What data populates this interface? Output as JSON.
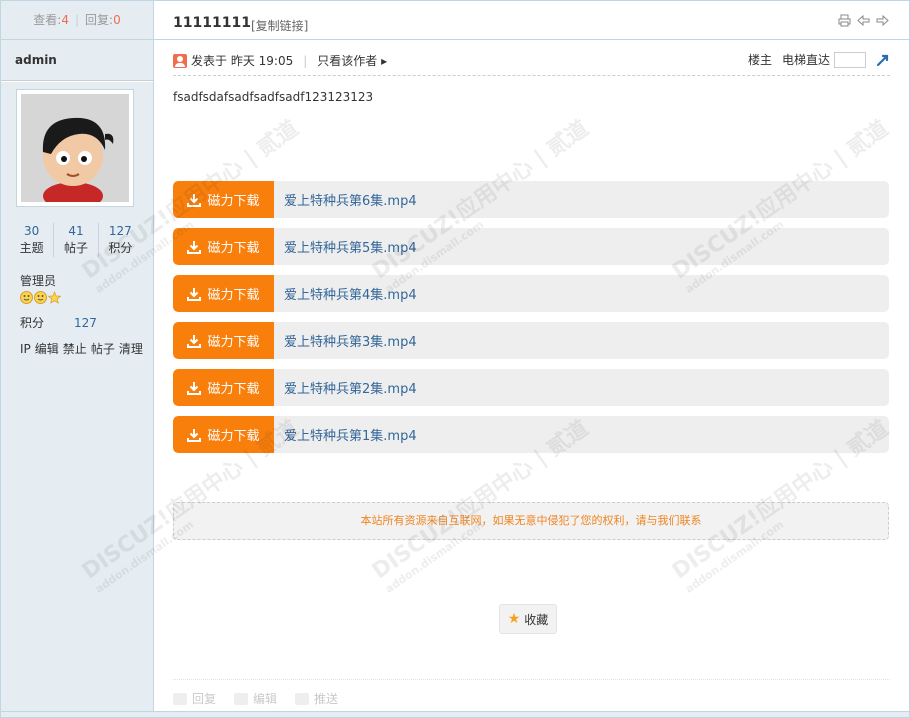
{
  "sidebar": {
    "views_label": "查看:",
    "views_value": "4",
    "replies_label": "回复:",
    "replies_value": "0",
    "author": "admin",
    "stats": [
      {
        "value": "30",
        "label": "主题"
      },
      {
        "value": "41",
        "label": "帖子"
      },
      {
        "value": "127",
        "label": "积分"
      }
    ],
    "group": "管理员",
    "score_label": "积分",
    "score_value": "127",
    "admin_links": [
      "IP",
      "编辑",
      "禁止",
      "帖子",
      "清理"
    ]
  },
  "header": {
    "title": "11111111",
    "copy_link": "[复制链接]"
  },
  "post": {
    "posted_label": "发表于 昨天 19:05",
    "only_author": "只看该作者",
    "floor_label": "楼主",
    "elevator_label": "电梯直达",
    "body_text": "fsadfsdafsadfsadfsadf123123123"
  },
  "downloads": {
    "button_label": "磁力下载",
    "items": [
      "爱上特种兵第6集.mp4",
      "爱上特种兵第5集.mp4",
      "爱上特种兵第4集.mp4",
      "爱上特种兵第3集.mp4",
      "爱上特种兵第2集.mp4",
      "爱上特种兵第1集.mp4"
    ]
  },
  "notice": "本站所有资源来自互联网，如果无意中侵犯了您的权利，请与我们联系",
  "favorite_label": "收藏",
  "actions": {
    "reply": "回复",
    "edit": "编辑",
    "push": "推送"
  },
  "watermark": {
    "main": "DISCUZ!应用中心 | 贰道",
    "sub": "addon.dismall.com"
  },
  "colors": {
    "accent": "#f97f0d",
    "link": "#336699",
    "sidebar_bg": "#e5edf2",
    "notice_text": "#f08420"
  }
}
